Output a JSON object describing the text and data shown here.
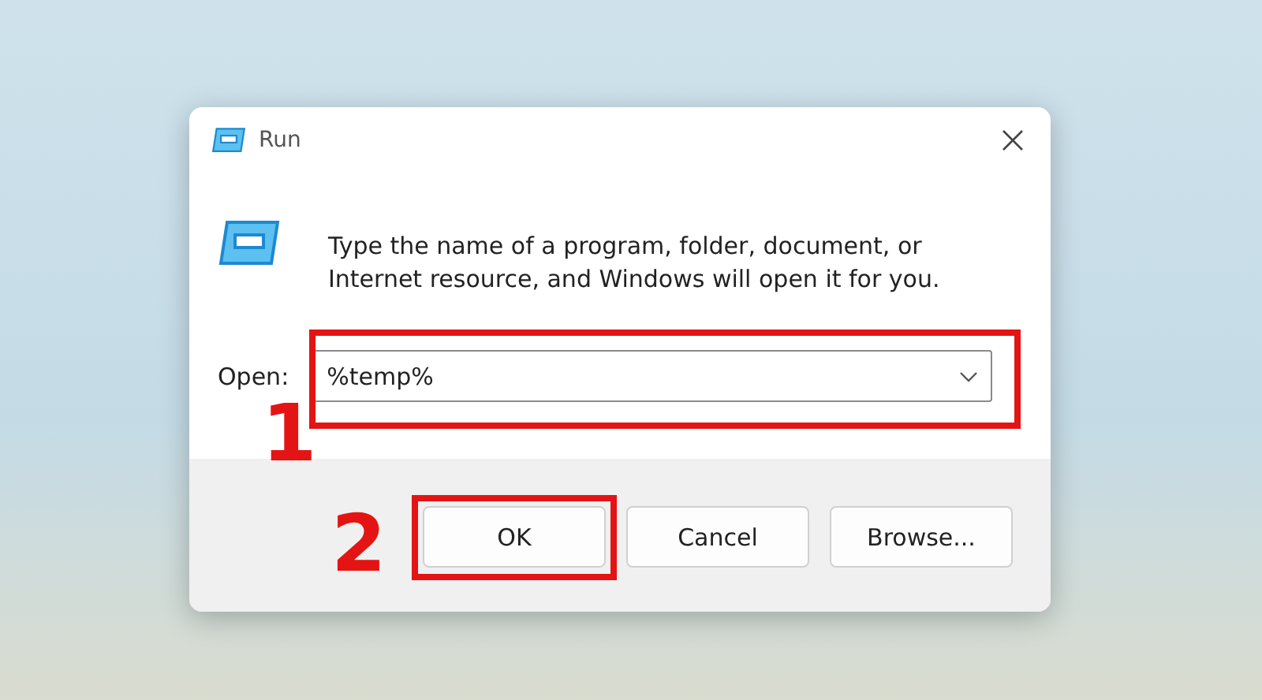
{
  "window": {
    "title": "Run"
  },
  "description": "Type the name of a program, folder, document, or Internet resource, and Windows will open it for you.",
  "open_field": {
    "label": "Open:",
    "value": "%temp%"
  },
  "buttons": [
    {
      "label": "OK"
    },
    {
      "label": "Cancel"
    },
    {
      "label": "Browse..."
    }
  ],
  "annotations": [
    {
      "label": "1",
      "kind": "field"
    },
    {
      "label": "2",
      "kind": "button"
    }
  ]
}
